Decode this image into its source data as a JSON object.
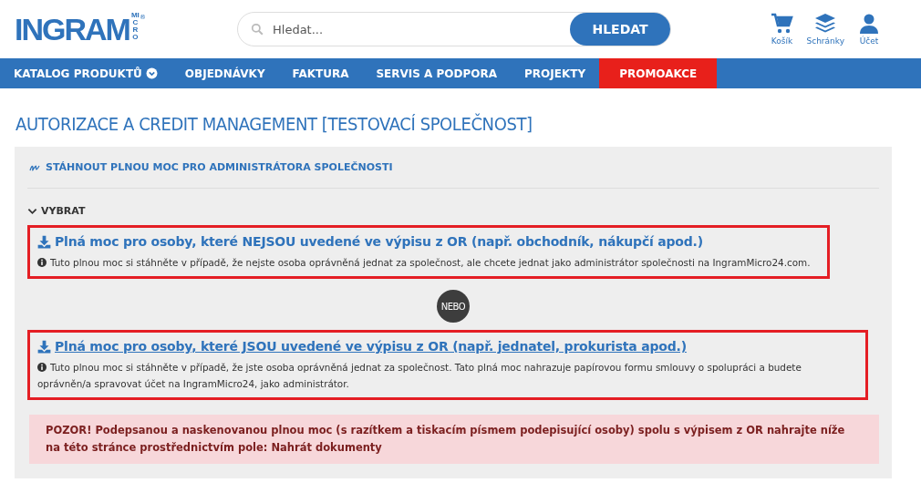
{
  "logo": {
    "name": "INGRAM",
    "sub": "MICRO",
    "mark": "®"
  },
  "search": {
    "placeholder": "Hledat...",
    "button": "HLEDAT"
  },
  "header_actions": [
    {
      "kind": "cart",
      "label": "Košík"
    },
    {
      "kind": "layers",
      "label": "Schránky"
    },
    {
      "kind": "user",
      "label": "Účet"
    }
  ],
  "nav": [
    {
      "label": "KATALOG PRODUKTŮ",
      "dropdown": true,
      "highlighted": false
    },
    {
      "label": "OBJEDNÁVKY",
      "dropdown": false,
      "highlighted": false
    },
    {
      "label": "FAKTURA",
      "dropdown": false,
      "highlighted": false
    },
    {
      "label": "SERVIS A PODPORA",
      "dropdown": false,
      "highlighted": false
    },
    {
      "label": "PROJEKTY",
      "dropdown": false,
      "highlighted": false
    },
    {
      "label": "PROMOAKCE",
      "dropdown": false,
      "highlighted": true
    }
  ],
  "page_title": "AUTORIZACE A CREDIT MANAGEMENT [TESTOVACÍ SPOLEČNOST]",
  "download_admin_link": "STÁHNOUT PLNOU MOC PRO ADMINISTRÁTORA SPOLEČNOSTI",
  "section": {
    "label": "VYBRAT",
    "expanded": true
  },
  "options": [
    {
      "title": "Plná moc pro osoby, které NEJSOU uvedené ve výpisu z OR (např. obchodník, nákupčí apod.)",
      "info": "Tuto plnou moc si stáhněte v případě, že nejste osoba oprávněná jednat za společnost, ale chcete jednat jako administrátor společnosti na IngramMicro24.com.",
      "highlighted": true,
      "underlined": false
    },
    {
      "title": "Plná moc pro osoby, které JSOU uvedené ve výpisu z OR (např. jednatel, prokurista apod.)",
      "info": "Tuto plnou moc si stáhněte v případě, že jste osoba oprávněná jednat za společnost. Tato plná moc nahrazuje papírovou formu smlouvy o spolupráci a budete oprávněn/a spravovat účet na IngramMicro24, jako administrátor.",
      "highlighted": true,
      "underlined": true
    }
  ],
  "separator": "NEBO",
  "warning": "POZOR! Podepsanou a naskenovanou plnou moc (s razítkem a tiskacím písmem podepisující osoby) spolu s výpisem z OR nahrajte níže na této stránce prostřednictvím pole: Nahrát dokumenty"
}
